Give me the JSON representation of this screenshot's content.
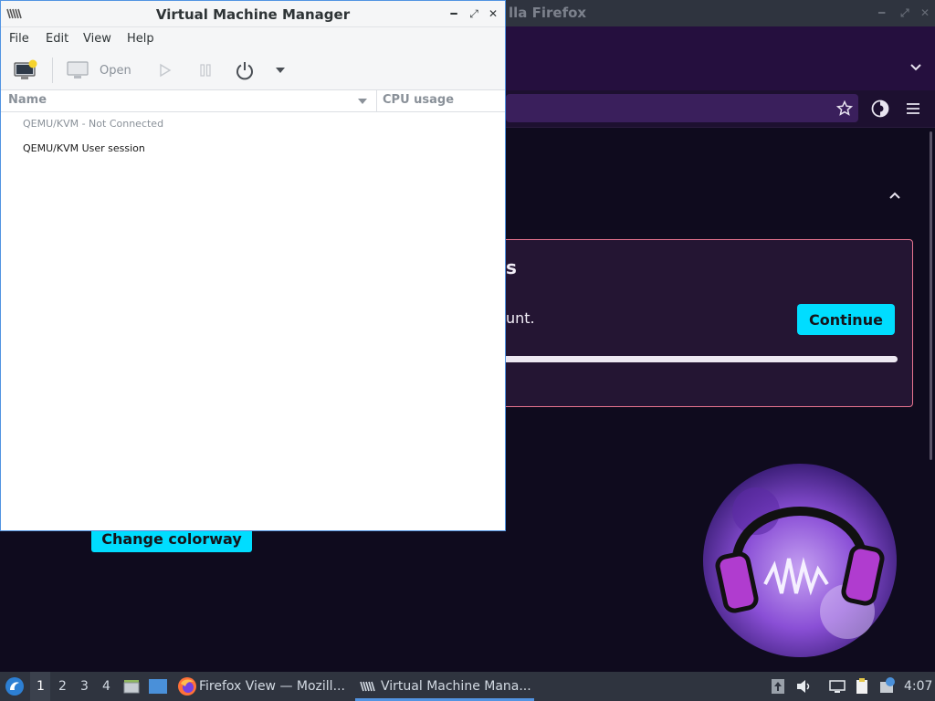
{
  "firefox": {
    "title": "Firefox View — Mozilla Firefox",
    "title_visible": "lla Firefox",
    "card_heading_tail": "s",
    "card_text_tail": "unt.",
    "continue_label": "Continue",
    "colorway_label": "Change colorway",
    "accent_color": "#00ddff",
    "bookmark_icon": "star-icon",
    "account_icon": "account-circle-icon",
    "menu_icon": "hamburger-menu-icon",
    "list_tabs_icon": "chevron-down-icon",
    "collapse_icon": "chevron-up-icon"
  },
  "vmm": {
    "title": "Virtual Machine Manager",
    "menu": [
      "File",
      "Edit",
      "View",
      "Help"
    ],
    "toolbar": {
      "new_vm_icon": "new-vm-icon",
      "open_label": "Open",
      "run_icon": "play-icon",
      "pause_icon": "pause-icon",
      "power_icon": "power-icon",
      "power_menu_icon": "dropdown-arrow-icon"
    },
    "columns": {
      "name": "Name",
      "cpu": "CPU usage"
    },
    "connections": [
      {
        "label": "QEMU/KVM - Not Connected",
        "connected": false
      },
      {
        "label": "QEMU/KVM User session",
        "connected": true
      }
    ],
    "window_controls": [
      "minimize",
      "maximize",
      "close"
    ]
  },
  "taskbar": {
    "workspaces": [
      "1",
      "2",
      "3",
      "4"
    ],
    "active_workspace": "1",
    "tasks": [
      {
        "label": "Firefox View — Mozill...",
        "icon": "firefox-icon"
      },
      {
        "label": "Virtual Machine Mana...",
        "icon": "virt-manager-icon",
        "active": true
      }
    ],
    "clock": "4:07",
    "tray_icons": [
      "updates-icon",
      "volume-icon",
      "network-icon",
      "clipboard-icon",
      "notification-icon"
    ]
  }
}
